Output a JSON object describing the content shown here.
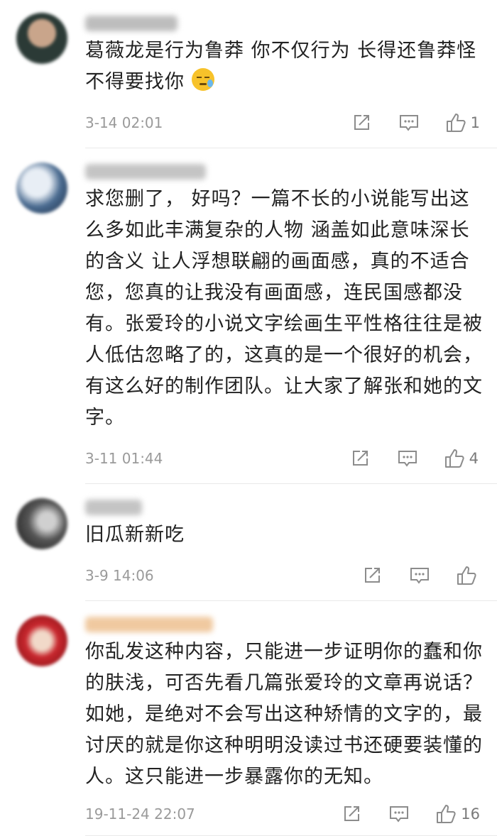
{
  "comments": [
    {
      "text": "葛薇龙是行为鲁莽 你不仅行为 长得还鲁莽怪不得要找你",
      "emoji": "sad-tear-emoji",
      "time": "3-14 02:01",
      "likes": "1"
    },
    {
      "text": "求您删了， 好吗？一篇不长的小说能写出这么多如此丰满复杂的人物 涵盖如此意味深长的含义 让人浮想联翩的画面感，真的不适合您，您真的让我没有画面感，连民国感都没有。张爱玲的小说文字绘画生平性格往往是被人低估忽略了的，这真的是一个很好的机会，有这么好的制作团队。让大家了解张和她的文字。",
      "time": "3-11 01:44",
      "likes": "4"
    },
    {
      "text": "旧瓜新新吃",
      "time": "3-9 14:06",
      "likes": ""
    },
    {
      "text": "你乱发这种内容，只能进一步证明你的蠢和你的肤浅，可否先看几篇张爱玲的文章再说话？如她，是绝对不会写出这种矫情的文字的，最讨厌的就是你这种明明没读过书还硬要装懂的人。这只能进一步暴露你的无知。",
      "time": "19-11-24 22:07",
      "likes": "16"
    }
  ],
  "icons": {
    "share": "share-icon",
    "comment": "comment-icon",
    "like": "thumbs-up-icon"
  },
  "colors": {
    "text": "#222222",
    "meta": "#9a9a9a",
    "divider": "#e9e9e9"
  }
}
